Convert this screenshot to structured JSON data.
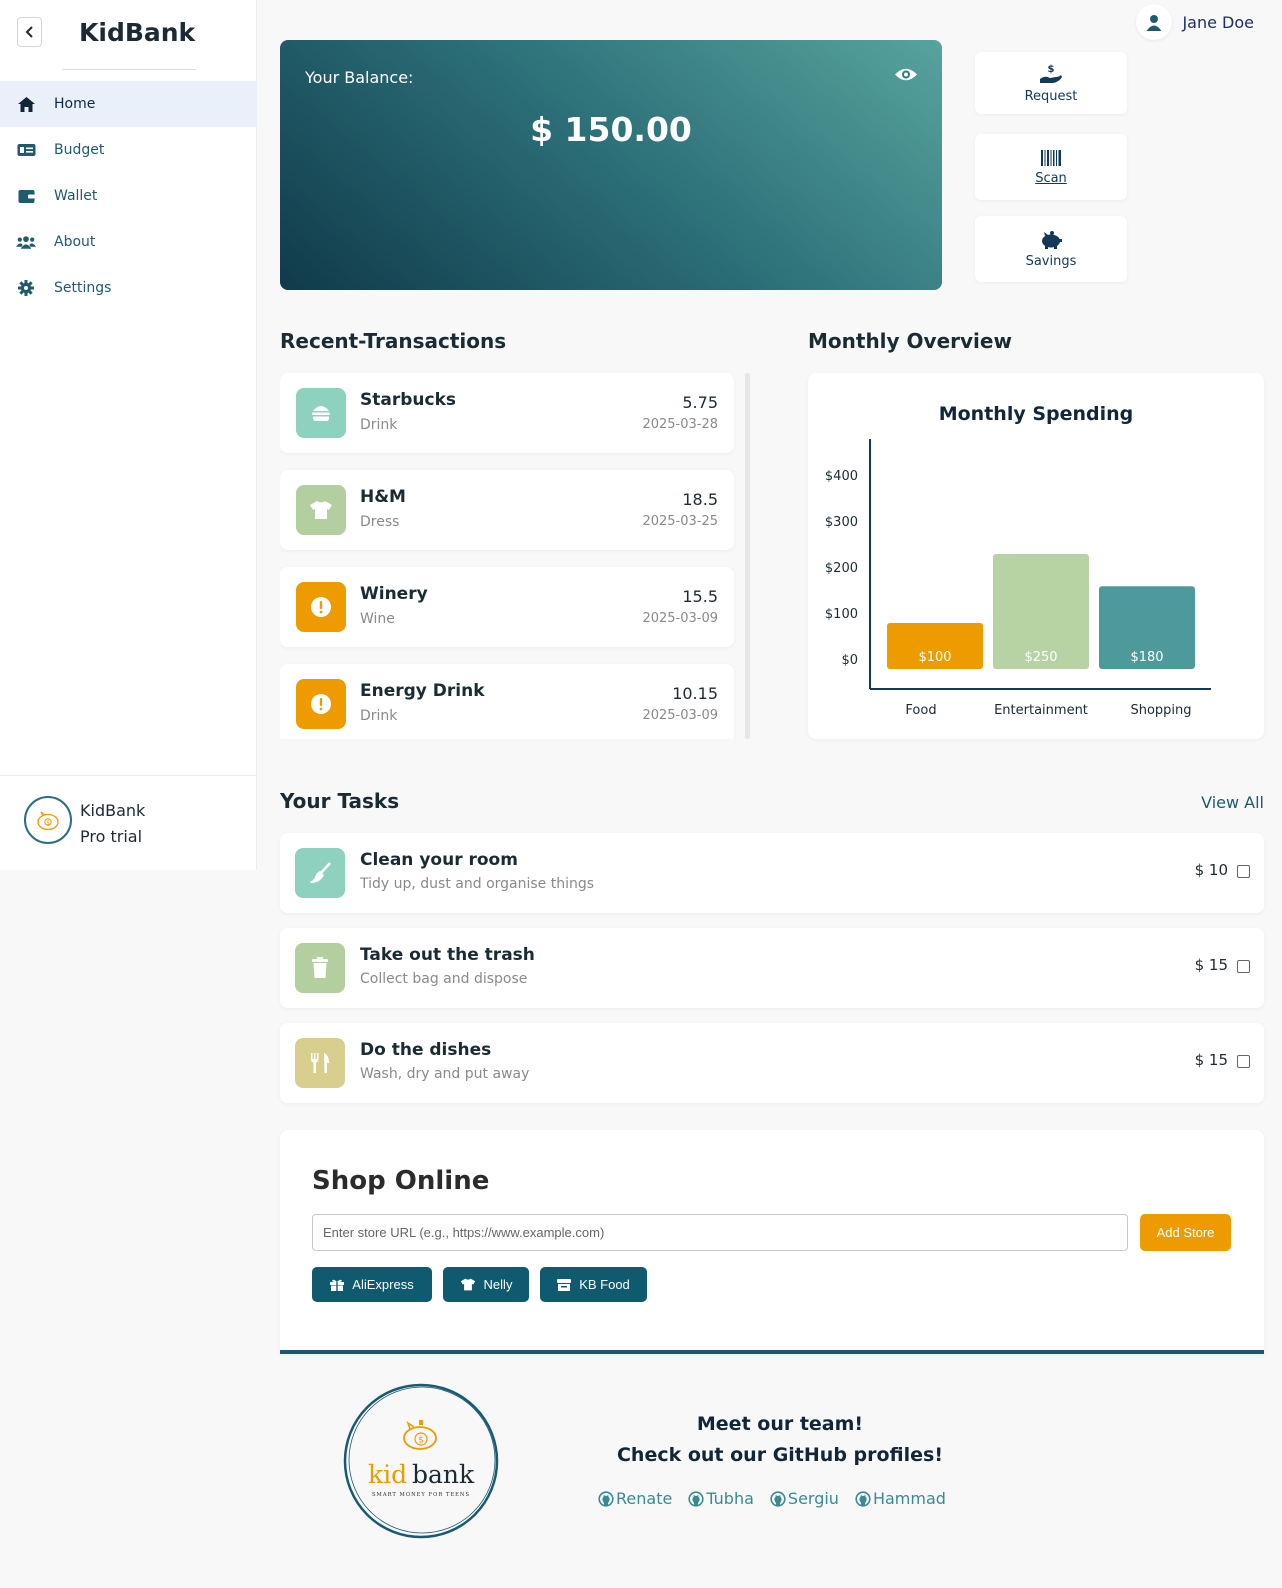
{
  "sidebar": {
    "brand": "KidBank",
    "items": [
      {
        "label": "Home",
        "icon": "home-icon"
      },
      {
        "label": "Budget",
        "icon": "budget-icon"
      },
      {
        "label": "Wallet",
        "icon": "wallet-icon"
      },
      {
        "label": "About",
        "icon": "users-icon"
      },
      {
        "label": "Settings",
        "icon": "gear-icon"
      }
    ],
    "footer": {
      "line1": "KidBank",
      "line2": "Pro trial"
    }
  },
  "user": {
    "name": "Jane Doe"
  },
  "balance": {
    "label": "Your Balance:",
    "amount": "$ 150.00"
  },
  "quick_actions": {
    "request": "Request",
    "scan": "Scan",
    "savings": "Savings"
  },
  "transactions": {
    "heading": "Recent-Transactions",
    "items": [
      {
        "name": "Starbucks",
        "category": "Drink",
        "amount": "5.75",
        "date": "2025-03-28",
        "icon": "burger-icon",
        "color": "#8fd1bf"
      },
      {
        "name": "H&M",
        "category": "Dress",
        "amount": "18.5",
        "date": "2025-03-25",
        "icon": "tshirt-icon",
        "color": "#b3cf9f"
      },
      {
        "name": "Winery",
        "category": "Wine",
        "amount": "15.5",
        "date": "2025-03-09",
        "icon": "alert-icon",
        "color": "#ee9b00"
      },
      {
        "name": "Energy Drink",
        "category": "Drink",
        "amount": "10.15",
        "date": "2025-03-09",
        "icon": "alert-icon",
        "color": "#ee9b00"
      }
    ]
  },
  "overview": {
    "heading": "Monthly Overview"
  },
  "chart_data": {
    "type": "bar",
    "title": "Monthly Spending",
    "categories": [
      "Food",
      "Entertainment",
      "Shopping"
    ],
    "values": [
      100,
      250,
      180
    ],
    "value_labels": [
      "$100",
      "$250",
      "$180"
    ],
    "colors": [
      "#ee9b00",
      "#b7d3a3",
      "#4e9a9a"
    ],
    "y_ticks": [
      "$0",
      "$100",
      "$200",
      "$300",
      "$400"
    ],
    "ylim": [
      0,
      400
    ],
    "xlabel": "",
    "ylabel": ""
  },
  "tasks": {
    "heading": "Your Tasks",
    "view_all": "View All",
    "items": [
      {
        "title": "Clean your room",
        "desc": "Tidy up, dust and organise things",
        "amount": "$ 10",
        "icon": "broom-icon",
        "color": "#8fd1bf"
      },
      {
        "title": "Take out the trash",
        "desc": "Collect bag and dispose",
        "amount": "$ 15",
        "icon": "trash-icon",
        "color": "#b3cf9f"
      },
      {
        "title": "Do the dishes",
        "desc": "Wash, dry and put away",
        "amount": "$ 15",
        "icon": "utensils-icon",
        "color": "#d8cf8f"
      }
    ]
  },
  "shop": {
    "title": "Shop Online",
    "placeholder": "Enter store URL (e.g., https://www.example.com)",
    "add_label": "Add Store",
    "stores": [
      "AliExpress",
      "Nelly",
      "KB Food"
    ]
  },
  "footer": {
    "line1": "Meet our team!",
    "line2": "Check out our GitHub profiles!",
    "logo_word1": "kid",
    "logo_word2": "bank",
    "logo_tagline": "SMART MONEY FOR TEENS",
    "links": [
      "Renate",
      "Tubha",
      "Sergiu",
      "Hammad"
    ]
  }
}
